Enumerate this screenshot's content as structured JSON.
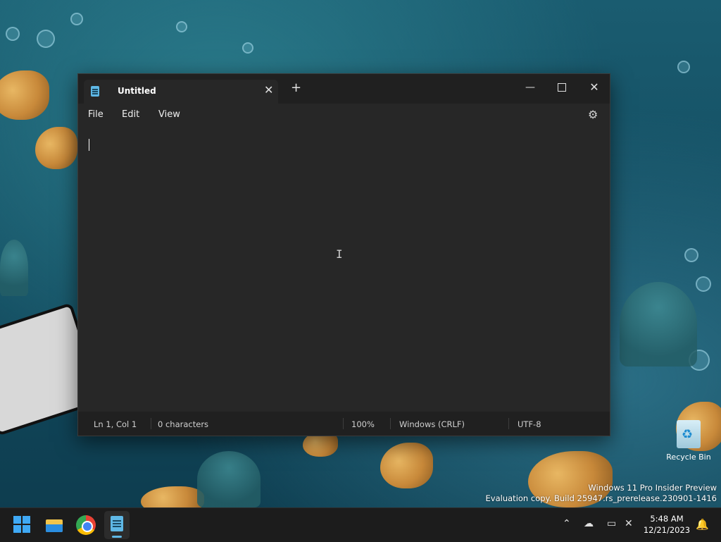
{
  "notepad": {
    "tab_title": "Untitled",
    "tab_close": "✕",
    "new_tab": "+",
    "minimize": "—",
    "close": "✕",
    "menu": {
      "file": "File",
      "edit": "Edit",
      "view": "View"
    },
    "settings_icon": "⚙",
    "status": {
      "position": "Ln 1, Col 1",
      "characters": "0 characters",
      "zoom": "100%",
      "line_ending": "Windows (CRLF)",
      "encoding": "UTF-8"
    }
  },
  "desktop": {
    "recycle_bin_label": "Recycle Bin",
    "recycle_icon": "♻",
    "watermark_line1": "Windows 11 Pro Insider Preview",
    "watermark_line2": "Evaluation copy. Build 25947.rs_prerelease.230901-1416"
  },
  "taskbar": {
    "tray_chevron": "⌃",
    "tray_network": "☁",
    "tray_display": "▭",
    "tray_volume": "✕",
    "time": "5:48 AM",
    "date": "12/21/2023",
    "notifications_icon": "🔔"
  },
  "colors": {
    "accent": "#3fa9f5",
    "window_bg": "#272727",
    "titlebar_bg": "#202020",
    "taskbar_bg": "#1c1c1c"
  }
}
